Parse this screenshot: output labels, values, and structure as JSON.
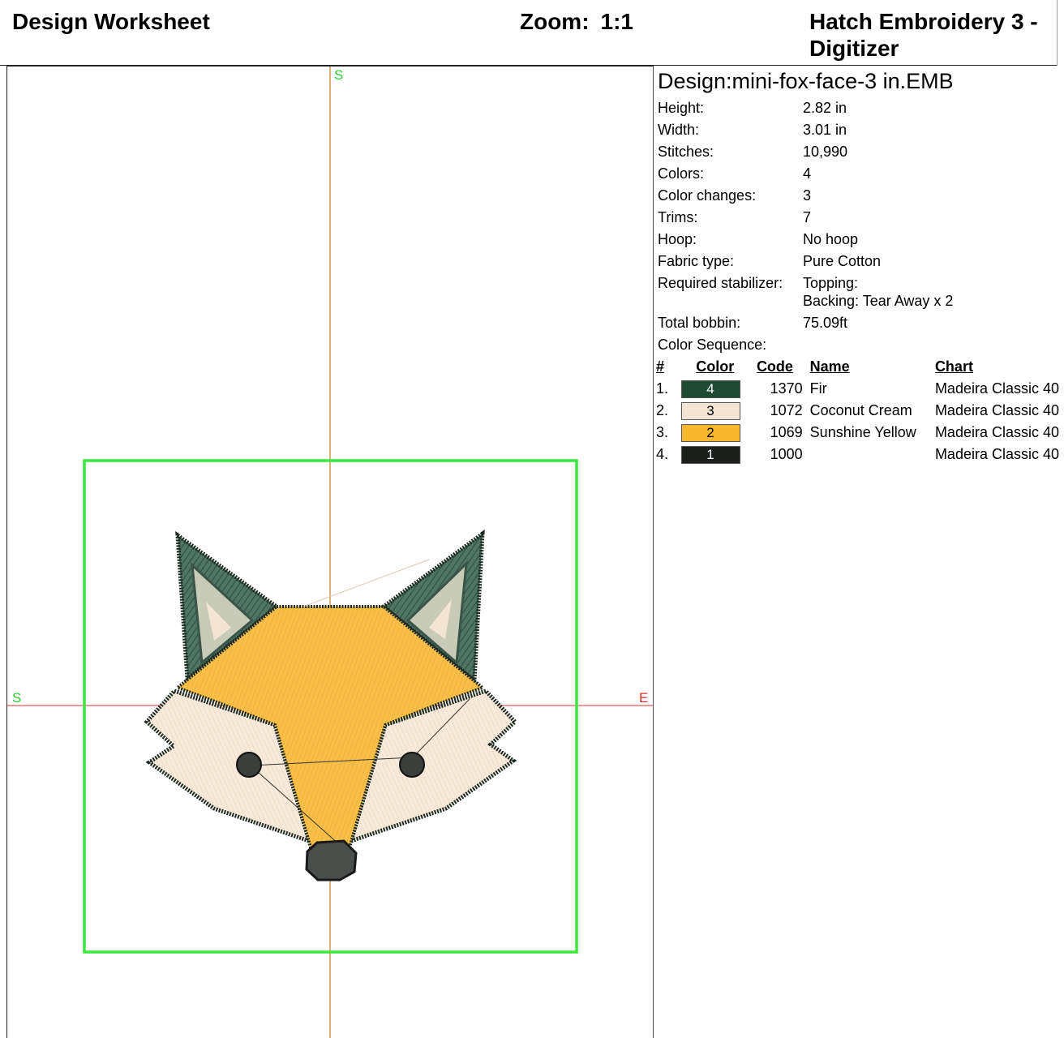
{
  "header": {
    "title": "Design Worksheet",
    "zoom_label": "Zoom:",
    "zoom_value": "1:1",
    "product": "Hatch Embroidery 3 - Digitizer"
  },
  "axes": {
    "north": "S",
    "west": "S",
    "east": "E"
  },
  "colors": {
    "hoop_green": "#3de83d",
    "vertical_axis": "#c6872c",
    "horizontal_axis": "#d93030",
    "label_green": "#2ecc2e",
    "label_red": "#d93030"
  },
  "design": {
    "name": "Design:mini-fox-face-3 in.EMB",
    "props": [
      {
        "label": "Height:",
        "value": "2.82 in"
      },
      {
        "label": "Width:",
        "value": "3.01 in"
      },
      {
        "label": "Stitches:",
        "value": "10,990"
      },
      {
        "label": "Colors:",
        "value": "4"
      },
      {
        "label": "Color changes:",
        "value": "3"
      },
      {
        "label": "Trims:",
        "value": "7"
      },
      {
        "label": "Hoop:",
        "value": "No hoop"
      },
      {
        "label": "Fabric type:",
        "value": "Pure Cotton"
      }
    ],
    "stabilizer": {
      "label": "Required stabilizer:",
      "topping": "Topping:",
      "backing": "Backing: Tear Away x 2"
    },
    "bobbin": {
      "label": "Total bobbin:",
      "value": "75.09ft"
    },
    "sequence_label": "Color Sequence:",
    "table_headers": {
      "num": "#",
      "color": "Color",
      "code": "Code",
      "name": "Name",
      "chart": "Chart"
    },
    "threads": [
      {
        "num": "1.",
        "swatch": "4",
        "hex": "#1f4a33",
        "dark": true,
        "code": "1370",
        "name": "Fir",
        "chart": "Madeira Classic 40"
      },
      {
        "num": "2.",
        "swatch": "3",
        "hex": "#f3e4d3",
        "dark": false,
        "code": "1072",
        "name": "Coconut Cream",
        "chart": "Madeira Classic 40"
      },
      {
        "num": "3.",
        "swatch": "2",
        "hex": "#f8b72f",
        "dark": false,
        "code": "1069",
        "name": "Sunshine Yellow",
        "chart": "Madeira Classic 40"
      },
      {
        "num": "4.",
        "swatch": "1",
        "hex": "#1b1f1c",
        "dark": true,
        "code": "1000",
        "name": "",
        "chart": "Madeira Classic 40"
      }
    ]
  }
}
